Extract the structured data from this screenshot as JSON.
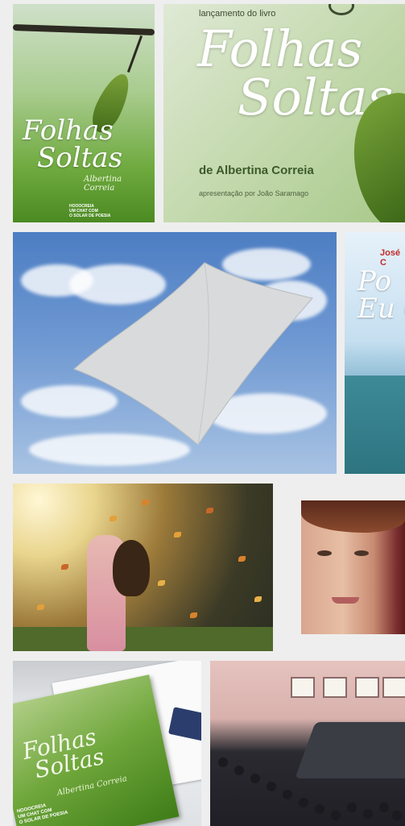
{
  "results": [
    {
      "id": "tile-1",
      "kind": "book-cover",
      "title_line1": "Folhas",
      "title_line2": "Soltas",
      "author": "Albertina Correia",
      "publisher_line1": "HOOOCREIA",
      "publisher_line2": "UM CHAT COM",
      "publisher_line3": "O SOLAR DE POESIA"
    },
    {
      "id": "tile-2",
      "kind": "launch-poster",
      "kicker": "lançamento do livro",
      "title_line1": "Folhas",
      "title_line2": "Soltas",
      "byline": "de Albertina Correia",
      "presenter": "apresentação por João Saramago"
    },
    {
      "id": "tile-3",
      "kind": "photo-paper-sky"
    },
    {
      "id": "tile-4",
      "kind": "book-cover-partial",
      "author": "José C",
      "title_line1": "Po",
      "title_line2": "Eu C"
    },
    {
      "id": "tile-5",
      "kind": "photo-autumn-leaves"
    },
    {
      "id": "tile-6",
      "kind": "photo-portrait"
    },
    {
      "id": "tile-7",
      "kind": "photo-book-on-desk",
      "title_line1": "Folhas",
      "title_line2": "Soltas",
      "author": "Albertina Correia",
      "publisher_line1": "HOOOCREIA",
      "publisher_line2": "UM CHAT COM",
      "publisher_line3": "O SOLAR DE POESIA"
    },
    {
      "id": "tile-8",
      "kind": "photo-audience-hall"
    }
  ],
  "colors": {
    "page_background": "#eeeeee",
    "leaf_green": "#4b8a22",
    "sky_blue": "#4d7ec3",
    "accent_red": "#c32b2b"
  }
}
